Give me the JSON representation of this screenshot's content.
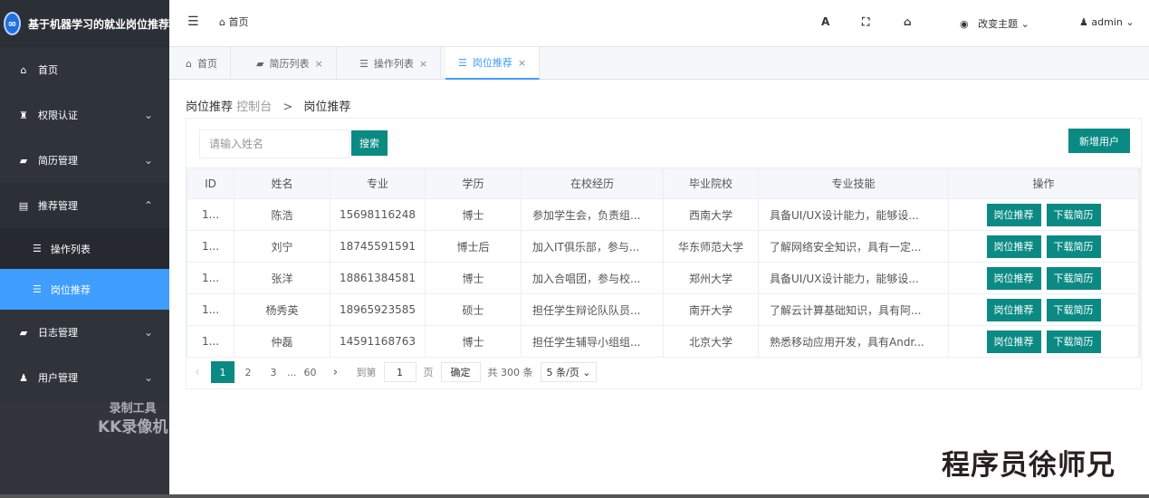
{
  "app": {
    "title": "基于机器学习的就业岗位推荐",
    "logo_glyph": "∞"
  },
  "sidebar": {
    "items": [
      {
        "label": "首页",
        "icon": "home-icon",
        "glyph": "⌂"
      },
      {
        "label": "权限认证",
        "icon": "user-key-icon",
        "glyph": "♜"
      },
      {
        "label": "简历管理",
        "icon": "car-icon",
        "glyph": "▰"
      },
      {
        "label": "推荐管理",
        "icon": "list-box-icon",
        "glyph": "▤"
      },
      {
        "label": "日志管理",
        "icon": "car-icon",
        "glyph": "▰"
      },
      {
        "label": "用户管理",
        "icon": "users-icon",
        "glyph": "♟"
      }
    ],
    "submenu": [
      {
        "label": "操作列表",
        "icon": "list-icon",
        "glyph": "☰",
        "active": false
      },
      {
        "label": "岗位推荐",
        "icon": "list-icon",
        "glyph": "☰",
        "active": true
      }
    ]
  },
  "watermark": {
    "line1": "录制工具",
    "line2": "KK录像机"
  },
  "topbar": {
    "home_label": "首页",
    "theme_label": "改变主题",
    "user_label": "admin"
  },
  "tabs": [
    {
      "label": "首页",
      "icon": "home-icon",
      "closable": false,
      "active": false
    },
    {
      "label": "简历列表",
      "icon": "car-icon",
      "closable": true,
      "active": false
    },
    {
      "label": "操作列表",
      "icon": "list-icon",
      "closable": true,
      "active": false
    },
    {
      "label": "岗位推荐",
      "icon": "list-icon",
      "closable": true,
      "active": true
    }
  ],
  "breadcrumb": {
    "current_section": "岗位推荐",
    "root": "控制台",
    "page": "岗位推荐"
  },
  "search": {
    "placeholder": "请输入姓名",
    "value": "",
    "button_label": "搜索"
  },
  "add_button_label": "新增用户",
  "table": {
    "columns": [
      "ID",
      "姓名",
      "专业",
      "学历",
      "在校经历",
      "毕业院校",
      "专业技能",
      "操作"
    ],
    "rows": [
      {
        "id": "1...",
        "name": "陈浩",
        "major": "15698116248",
        "degree": "博士",
        "experience": "参加学生会，负责组...",
        "school": "西南大学",
        "skills": "具备UI/UX设计能力，能够设..."
      },
      {
        "id": "1...",
        "name": "刘宁",
        "major": "18745591591",
        "degree": "博士后",
        "experience": "加入IT俱乐部，参与...",
        "school": "华东师范大学",
        "skills": "了解网络安全知识，具有一定..."
      },
      {
        "id": "1...",
        "name": "张洋",
        "major": "18861384581",
        "degree": "博士",
        "experience": "加入合唱团，参与校...",
        "school": "郑州大学",
        "skills": "具备UI/UX设计能力，能够设..."
      },
      {
        "id": "1...",
        "name": "杨秀英",
        "major": "18965923585",
        "degree": "硕士",
        "experience": "担任学生辩论队队员...",
        "school": "南开大学",
        "skills": "了解云计算基础知识，具有阿..."
      },
      {
        "id": "1...",
        "name": "仲磊",
        "major": "14591168763",
        "degree": "博士",
        "experience": "担任学生辅导小组组...",
        "school": "北京大学",
        "skills": "熟悉移动应用开发，具有Andr..."
      }
    ],
    "action_recommend": "岗位推荐",
    "action_download": "下载简历"
  },
  "pagination": {
    "pages": [
      "1",
      "2",
      "3"
    ],
    "ellipsis": "...",
    "last_page": "60",
    "current": "1",
    "goto_label": "到第",
    "goto_value": "1",
    "page_unit": "页",
    "confirm_label": "确定",
    "total_label": "共 300 条",
    "page_size_label": "5 条/页"
  },
  "signature": "程序员徐师兄"
}
